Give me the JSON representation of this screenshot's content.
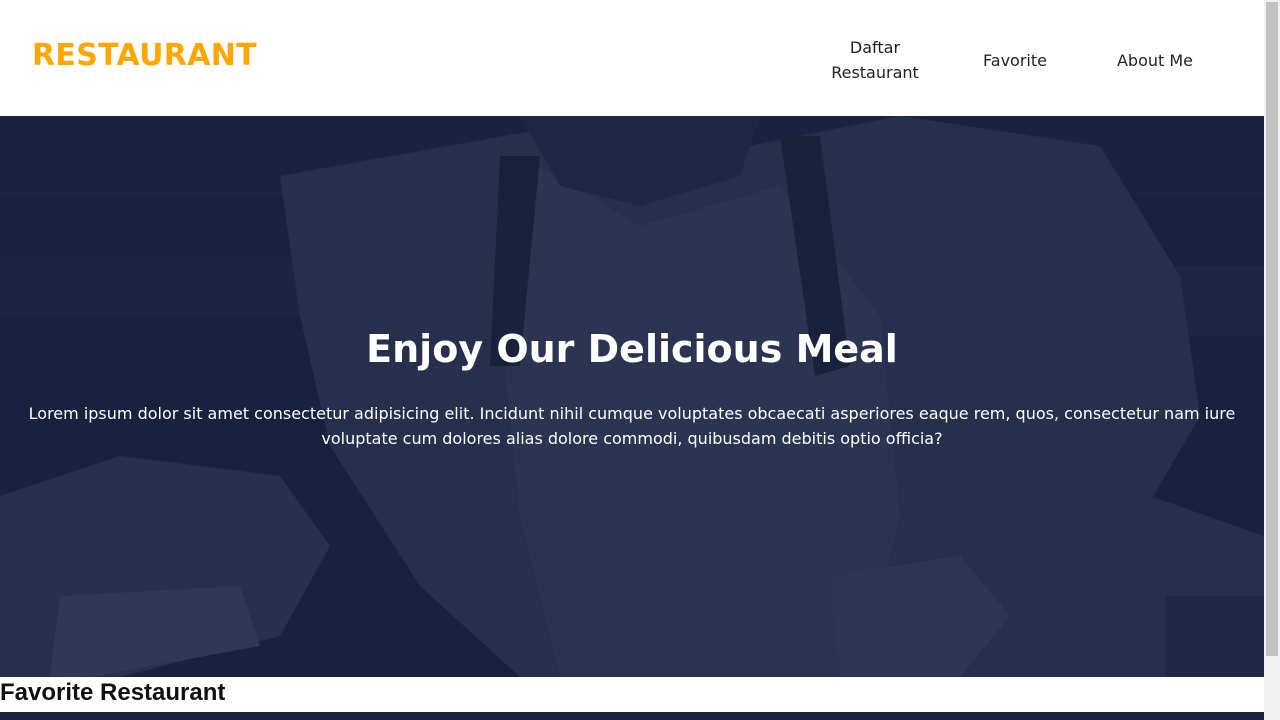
{
  "header": {
    "logo": "RESTAURANT",
    "nav": [
      {
        "label": "Daftar\nRestaurant"
      },
      {
        "label": "Favorite"
      },
      {
        "label": "About Me"
      }
    ]
  },
  "hero": {
    "title": "Enjoy Our Delicious Meal",
    "text": "Lorem ipsum dolor sit amet consectetur adipisicing elit. Incidunt nihil cumque voluptates obcaecati asperiores eaque rem, quos, consectetur nam iure voluptate cum dolores alias dolore commodi, quibusdam debitis optio officia?"
  },
  "section": {
    "title": "Favorite Restaurant"
  },
  "colors": {
    "accent": "#ffa600",
    "hero_bg": "#1b2540"
  }
}
